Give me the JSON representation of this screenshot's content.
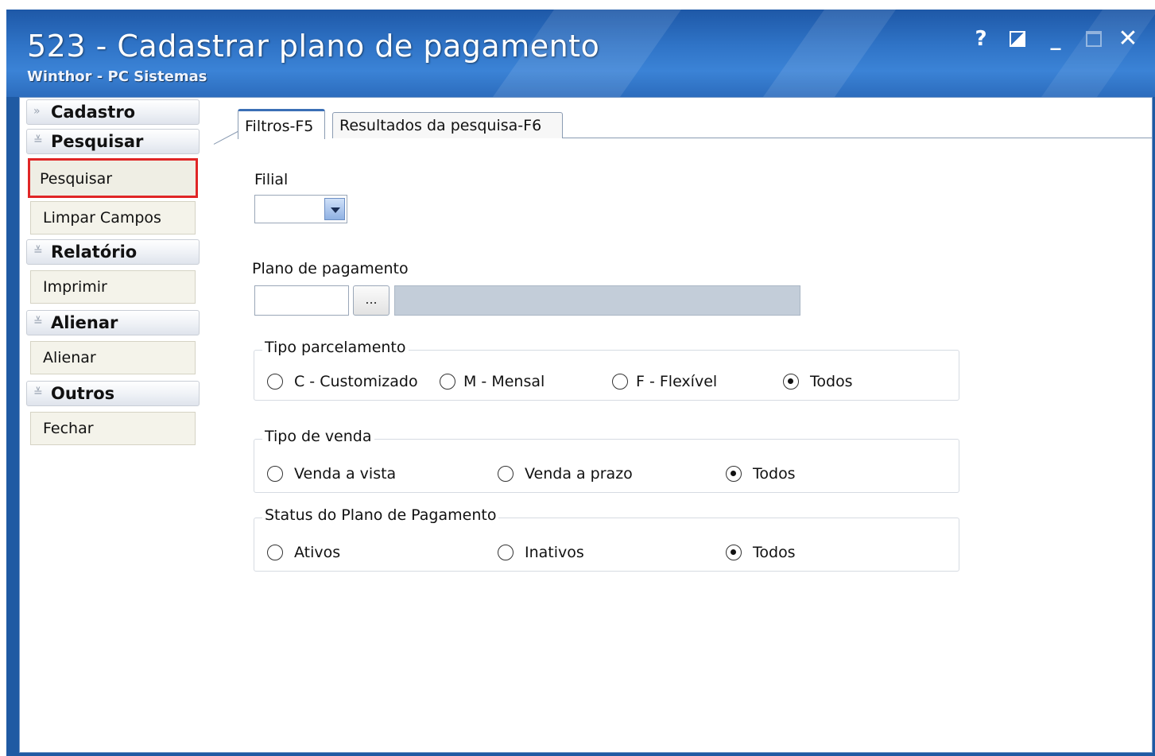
{
  "window": {
    "title": "523 - Cadastrar plano de pagamento",
    "subtitle": "Winthor - PC Sistemas",
    "controls": {
      "help": "?",
      "minimize": "_",
      "close": "✕"
    }
  },
  "sidebar": {
    "groups": [
      {
        "label": "Cadastro",
        "expanded": false
      },
      {
        "label": "Pesquisar",
        "expanded": true,
        "items": [
          "Pesquisar",
          "Limpar Campos"
        ]
      },
      {
        "label": "Relatório",
        "expanded": true,
        "items": [
          "Imprimir"
        ]
      },
      {
        "label": "Alienar",
        "expanded": true,
        "items": [
          "Alienar"
        ]
      },
      {
        "label": "Outros",
        "expanded": true,
        "items": [
          "Fechar"
        ]
      }
    ]
  },
  "tabs": [
    {
      "label": "Filtros-F5",
      "active": true
    },
    {
      "label": "Resultados da pesquisa-F6",
      "active": false
    }
  ],
  "form": {
    "filial_label": "Filial",
    "filial_value": "",
    "plano_label": "Plano de pagamento",
    "plano_code": "",
    "plano_lookup_label": "...",
    "plano_desc": "",
    "tipo_parcelamento": {
      "legend": "Tipo parcelamento",
      "options": [
        "C - Customizado",
        "M - Mensal",
        "F - Flexível",
        "Todos"
      ],
      "selected": "Todos"
    },
    "tipo_venda": {
      "legend": "Tipo de venda",
      "options": [
        "Venda a vista",
        "Venda a prazo",
        "Todos"
      ],
      "selected": "Todos"
    },
    "status": {
      "legend": "Status do Plano de Pagamento",
      "options": [
        "Ativos",
        "Inativos",
        "Todos"
      ],
      "selected": "Todos"
    }
  },
  "colors": {
    "titlebar": "#2f73c6",
    "highlight_border": "#e02626",
    "sidebar_item_bg": "#f4f3ea"
  }
}
